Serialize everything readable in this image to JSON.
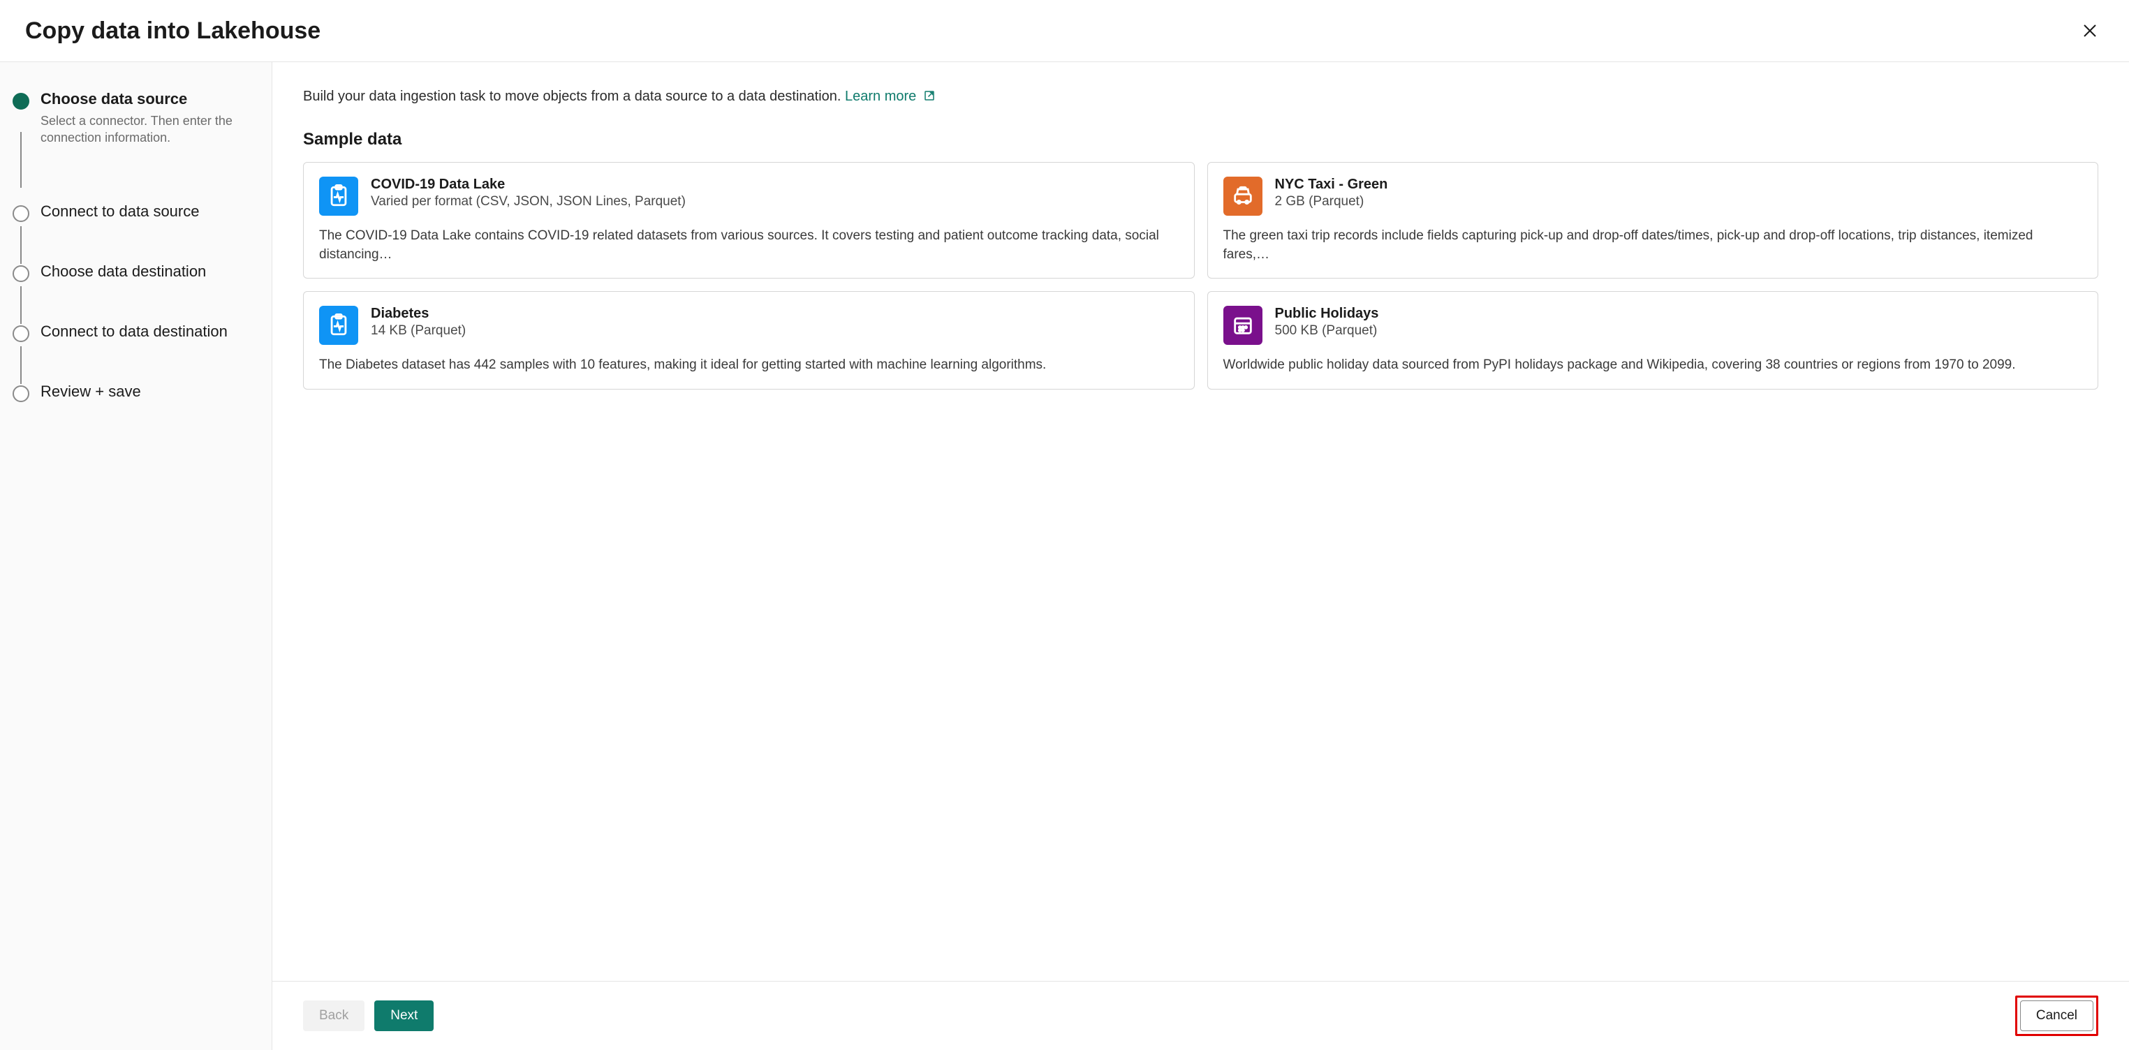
{
  "dialog": {
    "title": "Copy data into Lakehouse"
  },
  "steps": [
    {
      "title": "Choose data source",
      "desc": "Select a connector. Then enter the connection information.",
      "active": true
    },
    {
      "title": "Connect to data source"
    },
    {
      "title": "Choose data destination"
    },
    {
      "title": "Connect to data destination"
    },
    {
      "title": "Review + save"
    }
  ],
  "intro": {
    "text": "Build your data ingestion task to move objects from a data source to a data destination. ",
    "learn_more": "Learn more"
  },
  "section_title": "Sample data",
  "cards": [
    {
      "title": "COVID-19 Data Lake",
      "sub": "Varied per format (CSV, JSON, JSON Lines, Parquet)",
      "desc": "The COVID-19 Data Lake contains COVID-19 related datasets from various sources. It covers testing and patient outcome tracking data, social distancing…",
      "icon": "clipboard-pulse",
      "color": "ic-blue"
    },
    {
      "title": "NYC Taxi - Green",
      "sub": "2 GB (Parquet)",
      "desc": "The green taxi trip records include fields capturing pick-up and drop-off dates/times, pick-up and drop-off locations, trip distances, itemized fares,…",
      "icon": "taxi",
      "color": "ic-orange"
    },
    {
      "title": "Diabetes",
      "sub": "14 KB (Parquet)",
      "desc": "The Diabetes dataset has 442 samples with 10 features, making it ideal for getting started with machine learning algorithms.",
      "icon": "clipboard-pulse",
      "color": "ic-blue"
    },
    {
      "title": "Public Holidays",
      "sub": "500 KB (Parquet)",
      "desc": "Worldwide public holiday data sourced from PyPI holidays package and Wikipedia, covering 38 countries or regions from 1970 to 2099.",
      "icon": "calendar",
      "color": "ic-purple"
    }
  ],
  "footer": {
    "back": "Back",
    "next": "Next",
    "cancel": "Cancel"
  }
}
